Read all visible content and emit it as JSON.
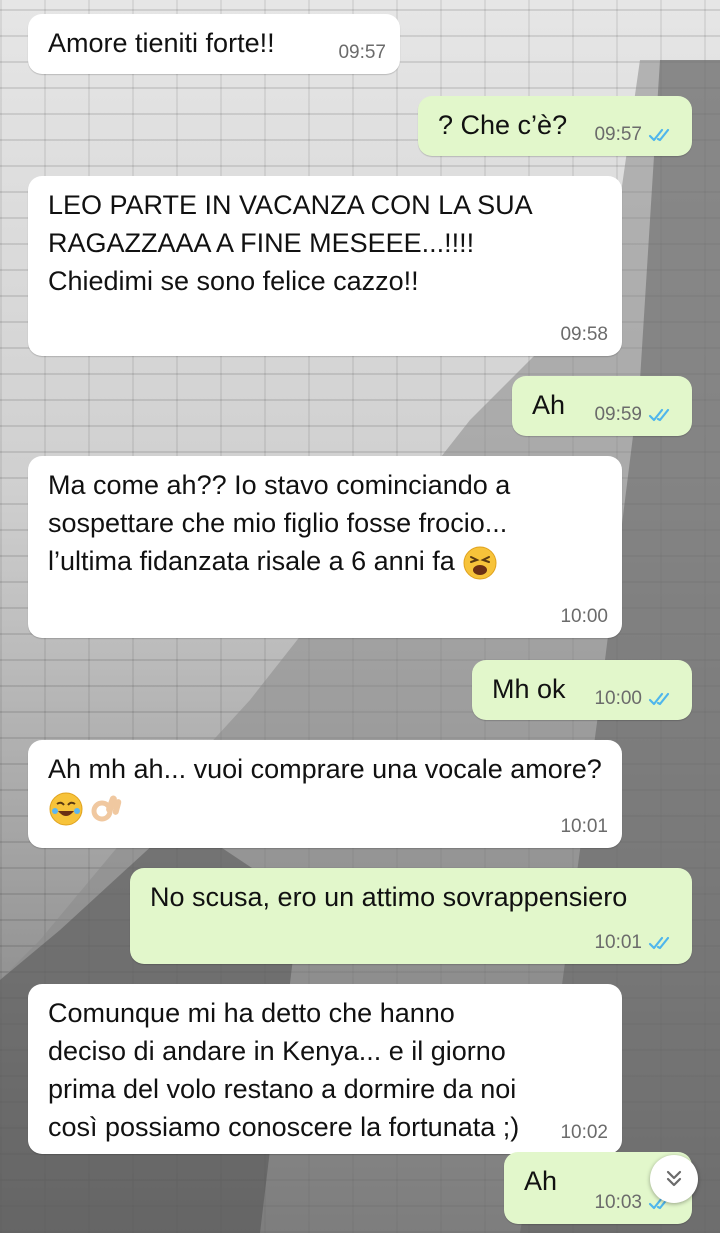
{
  "colors": {
    "incoming_bubble": "#ffffff",
    "outgoing_bubble": "#e2f7cb",
    "read_ticks": "#4fb6ec",
    "timestamp": "#6b6b6b"
  },
  "messages": [
    {
      "direction": "in",
      "text": "Amore tieniti forte!!",
      "time": "09:57"
    },
    {
      "direction": "out",
      "text": "? Che c’è?",
      "time": "09:57",
      "status_icon": "double-check-read"
    },
    {
      "direction": "in",
      "text": "LEO PARTE IN VACANZA CON LA SUA RAGAZZAAA A FINE MESEEE...!!!!\nChiedimi se sono felice cazzo!!",
      "time": "09:58"
    },
    {
      "direction": "out",
      "text": "Ah",
      "time": "09:59",
      "status_icon": "double-check-read"
    },
    {
      "direction": "in",
      "text": "Ma come ah?? Io stavo cominciando a sospettare che mio figlio fosse frocio... l’ultima fidanzata risale a 6 anni fa",
      "emoji": [
        "tired-face"
      ],
      "time": "10:00"
    },
    {
      "direction": "out",
      "text": "Mh ok",
      "time": "10:00",
      "status_icon": "double-check-read"
    },
    {
      "direction": "in",
      "text": "Ah mh ah... vuoi comprare una vocale amore?",
      "emoji": [
        "rolling-laughing-face",
        "ok-hand"
      ],
      "time": "10:01"
    },
    {
      "direction": "out",
      "text": "No scusa, ero un attimo sovrappensiero",
      "time": "10:01",
      "status_icon": "double-check-read"
    },
    {
      "direction": "in",
      "text": "Comunque mi ha detto che hanno deciso di andare in Kenya... e il giorno prima del volo restano a dormire da noi così possiamo conoscere la fortunata ;)",
      "time": "10:02"
    },
    {
      "direction": "out",
      "text": "Ah",
      "time": "10:03",
      "status_icon": "double-check-read"
    }
  ],
  "scroll_button_icon": "chevron-double-down-icon"
}
